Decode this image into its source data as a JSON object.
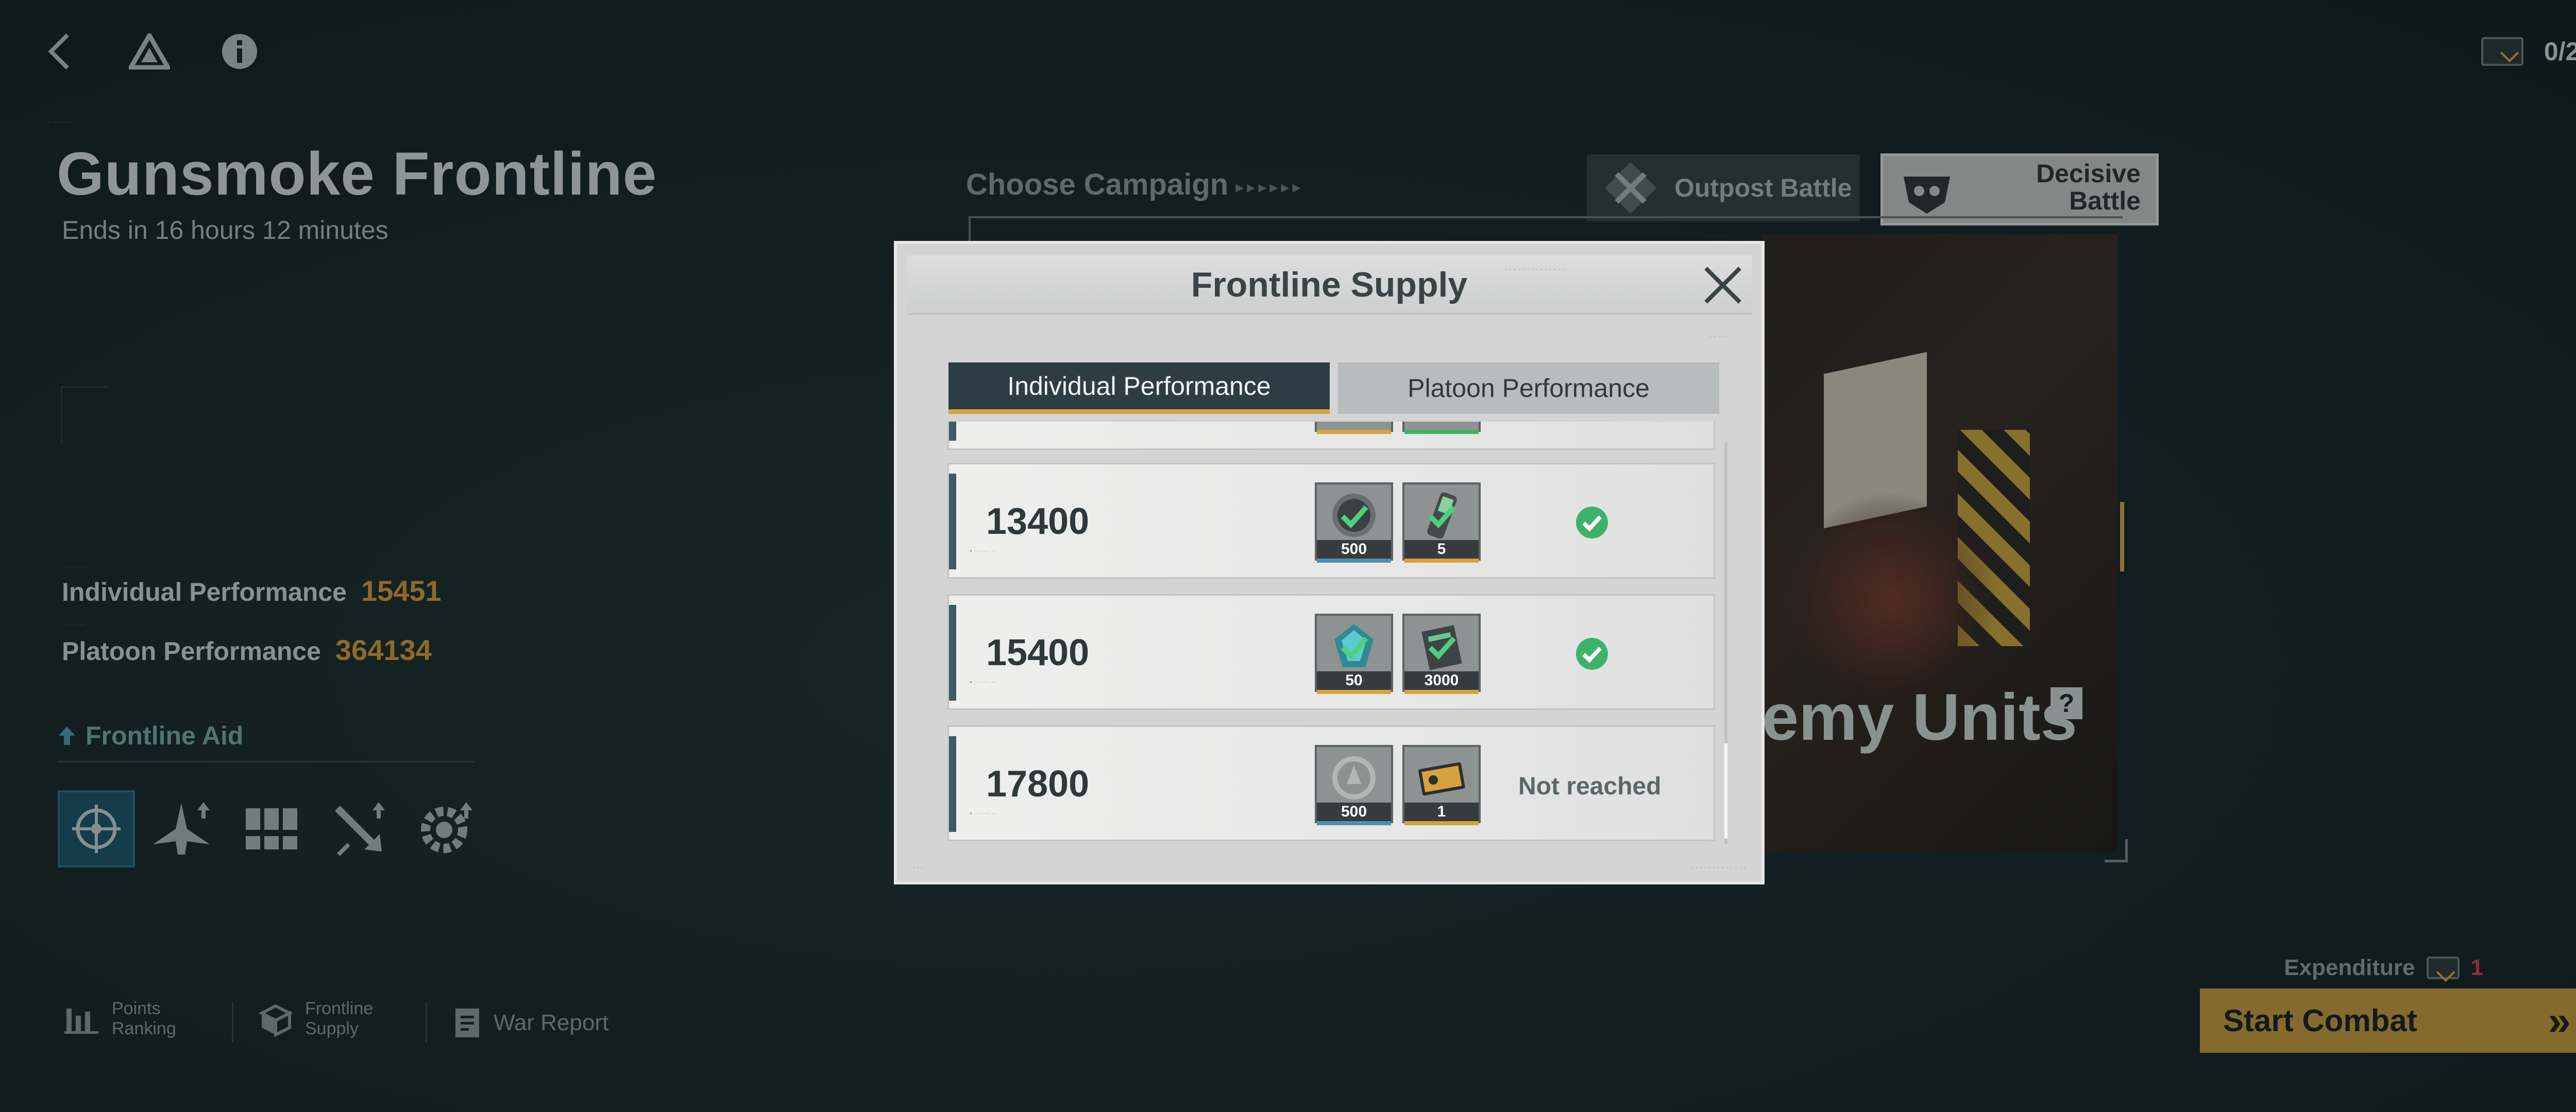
{
  "top_bar": {
    "back_icon": "back-chevron-icon",
    "drive_icon": "triangle-logo-icon",
    "info_icon": "info-icon",
    "ticket_count": "0/2",
    "plus_label": "+"
  },
  "event": {
    "title": "Gunsmoke Frontline",
    "ends": "Ends in 16 hours 12 minutes",
    "individual_label": "Individual Performance",
    "individual_value": "15451",
    "platoon_label": "Platoon Performance",
    "platoon_value": "364134"
  },
  "frontline_aid": {
    "title": "Frontline Aid",
    "icons": [
      "target-compass-icon",
      "jet-upgrade-icon",
      "bunker-icon",
      "strike-arrow-icon",
      "gear-upgrade-icon"
    ]
  },
  "bottom_nav": {
    "items": [
      {
        "label_line1": "Points",
        "label_line2": "Ranking",
        "icon": "bar-chart-icon"
      },
      {
        "label_line1": "Frontline",
        "label_line2": "Supply",
        "icon": "supply-box-icon"
      },
      {
        "label": "War Report",
        "icon": "document-icon"
      }
    ]
  },
  "campaign": {
    "choose_label": "Choose Campaign",
    "tab_outpost": "Outpost Battle",
    "tab_decisive": "Decisive Battle",
    "enemy_label": "emy Units",
    "help_label": "?"
  },
  "combat": {
    "expenditure_label": "Expenditure",
    "expenditure_value": "1",
    "start_label": "Start Combat",
    "start_arrow": "»"
  },
  "modal": {
    "title": "Frontline Supply",
    "tabs": [
      {
        "label": "Individual Performance",
        "active": true
      },
      {
        "label": "Platoon Performance",
        "active": false
      }
    ],
    "rows": [
      {
        "threshold": "13400",
        "rewards": [
          {
            "icon": "coin-token-icon",
            "qty": "500",
            "rarity_color": "#4d8fb0"
          },
          {
            "icon": "battery-capsule-icon",
            "qty": "5",
            "rarity_color": "#d6a23e"
          }
        ],
        "status": "claimed"
      },
      {
        "threshold": "15400",
        "rewards": [
          {
            "icon": "crystal-icon",
            "qty": "50",
            "rarity_color": "#d6a23e"
          },
          {
            "icon": "data-card-icon",
            "qty": "3000",
            "rarity_color": "#d6a23e"
          }
        ],
        "status": "claimed"
      },
      {
        "threshold": "17800",
        "rewards": [
          {
            "icon": "coin-token-icon",
            "qty": "500",
            "rarity_color": "#4d8fb0"
          },
          {
            "icon": "ticket-voucher-icon",
            "qty": "1",
            "rarity_color": "#d6a23e"
          }
        ],
        "status": "Not reached"
      }
    ],
    "close_icon": "close-icon",
    "status_claimed_icon": "check-circle-icon"
  },
  "colors": {
    "accent_gold": "#d6a23e",
    "perf_value": "#d49a3a",
    "success_green": "#3fb26a",
    "dark_panel": "#2e3d44"
  }
}
